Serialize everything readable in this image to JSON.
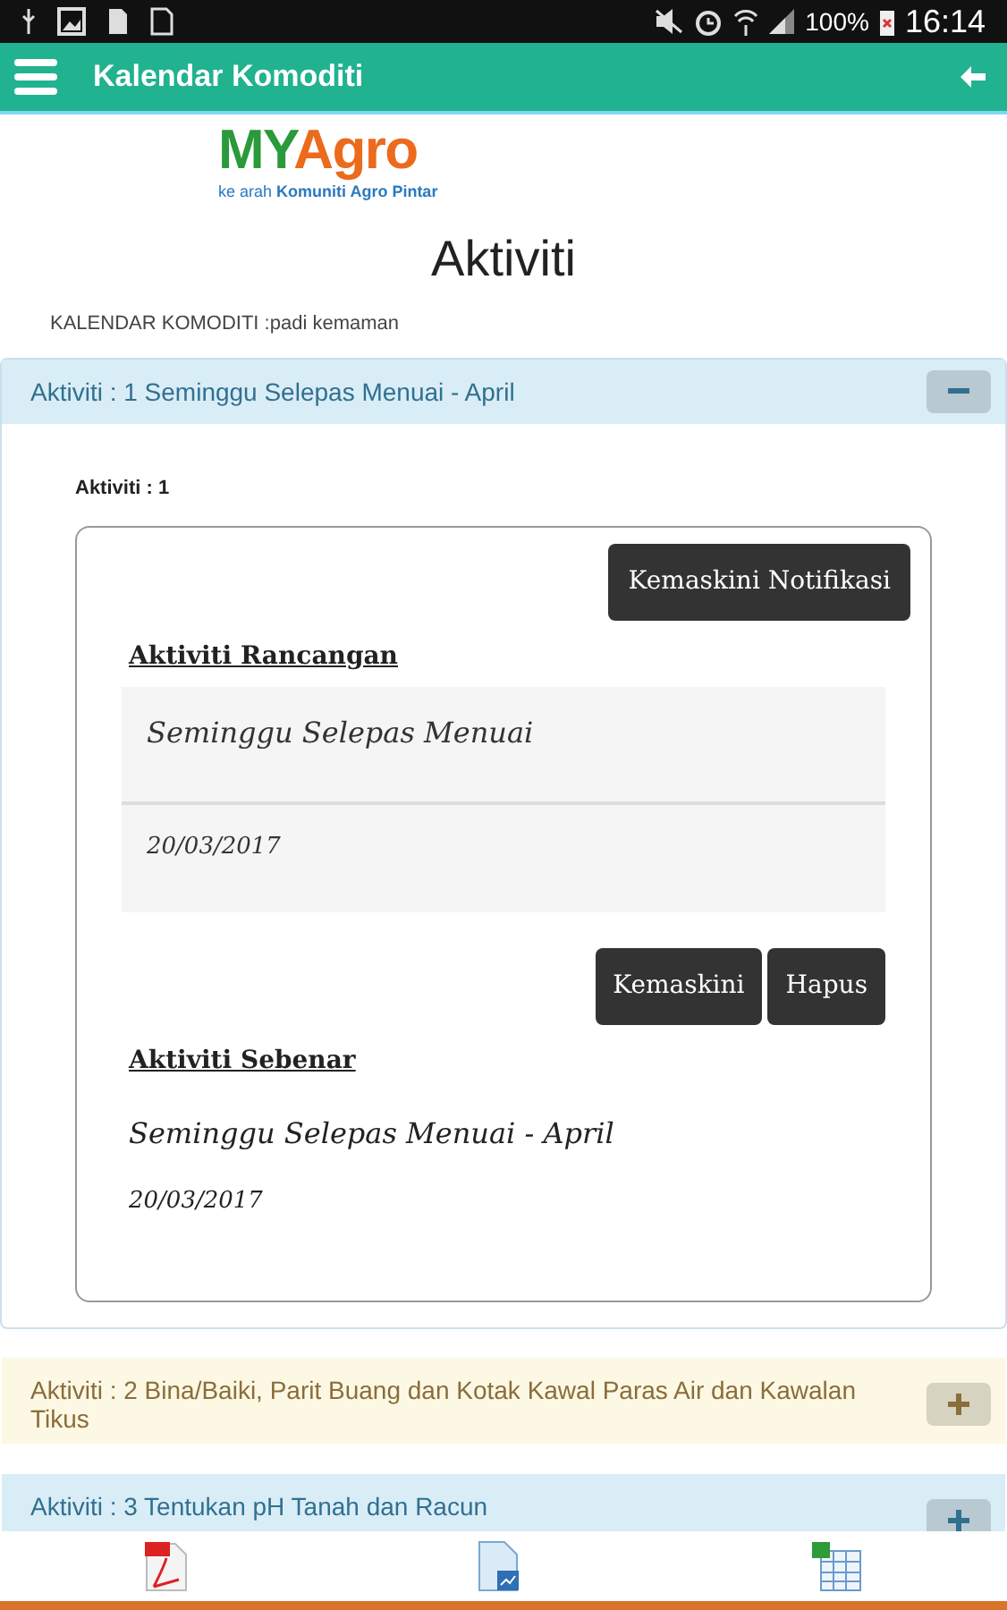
{
  "status_bar": {
    "battery": "100%",
    "time": "16:14"
  },
  "app_bar": {
    "title": "Kalendar Komoditi"
  },
  "logo": {
    "brand_a": "MY",
    "brand_b": "Agro",
    "tagline_a": "ke arah",
    "tagline_b": "Komuniti Agro Pintar"
  },
  "page_title": "Aktiviti",
  "subtitle": "KALENDAR KOMODITI :padi kemaman",
  "panels": [
    {
      "title": "Aktiviti : 1 Seminggu Selepas Menuai - April",
      "color": "#d9edf7",
      "expanded": true,
      "body": {
        "label": "Aktiviti : 1",
        "notify_button": "Kemaskini Notifikasi",
        "planned_heading": "Aktiviti Rancangan",
        "planned_name": "Seminggu Selepas Menuai",
        "planned_date": "20/03/2017",
        "update_button": "Kemaskini",
        "delete_button": "Hapus",
        "actual_heading": "Aktiviti Sebenar",
        "actual_name": "Seminggu Selepas Menuai - April",
        "actual_date": "20/03/2017"
      }
    },
    {
      "title": "Aktiviti : 2 Bina/Baiki, Parit Buang dan Kotak Kawal Paras Air dan Kawalan Tikus",
      "color": "#fcf8e3",
      "expanded": false
    },
    {
      "title": "Aktiviti : 3 Tentukan pH Tanah dan Racun",
      "color": "#d9edf7",
      "expanded": false
    }
  ]
}
